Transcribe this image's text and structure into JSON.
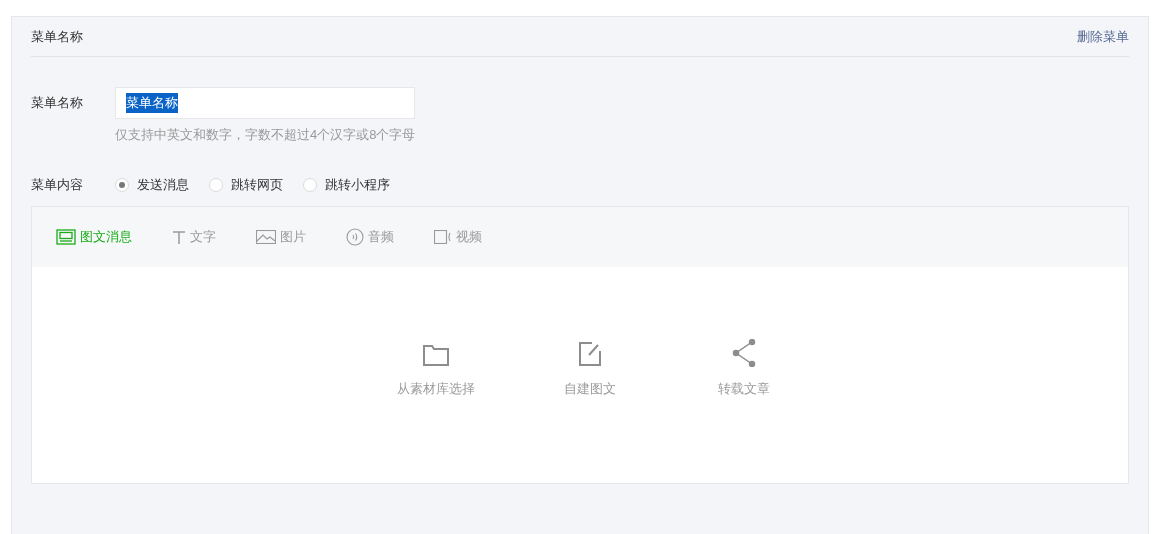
{
  "header": {
    "title": "菜单名称",
    "delete_link": "删除菜单"
  },
  "name_field": {
    "label": "菜单名称",
    "value": "菜单名称",
    "hint": "仅支持中英文和数字，字数不超过4个汉字或8个字母"
  },
  "content": {
    "label": "菜单内容",
    "options": [
      {
        "label": "发送消息",
        "selected": true
      },
      {
        "label": "跳转网页",
        "selected": false
      },
      {
        "label": "跳转小程序",
        "selected": false
      }
    ]
  },
  "tabs": [
    {
      "kind": "news",
      "label": "图文消息",
      "selected": true
    },
    {
      "kind": "text",
      "label": "文字",
      "selected": false
    },
    {
      "kind": "image",
      "label": "图片",
      "selected": false
    },
    {
      "kind": "audio",
      "label": "音频",
      "selected": false
    },
    {
      "kind": "video",
      "label": "视频",
      "selected": false
    }
  ],
  "actions": [
    {
      "kind": "folder",
      "label": "从素材库选择"
    },
    {
      "kind": "edit",
      "label": "自建图文"
    },
    {
      "kind": "share",
      "label": "转载文章"
    }
  ]
}
